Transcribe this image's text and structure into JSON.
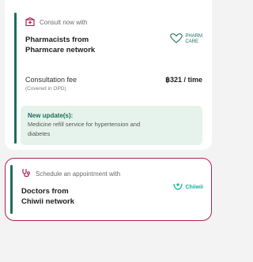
{
  "pharmacy_card": {
    "consult_label": "Consult now with",
    "title_line1": "Pharmacists from",
    "title_line2": "Pharmcare network",
    "brand_line1": "PHARM",
    "brand_line2": "CARE",
    "fee_label": "Consultation fee",
    "fee_value": "฿321 / time",
    "fee_note": "(Covered in OPD)",
    "update_title": "New update(s):",
    "update_text_line1": "Medicine refill service for hypertension and",
    "update_text_line2": "diabetes"
  },
  "doctor_card": {
    "schedule_label": "Schedule an appointment with",
    "title_line1": "Doctors from",
    "title_line2": "Chiwii network",
    "brand": "Chiiwii"
  },
  "colors": {
    "accent_green": "#1d6e5a",
    "accent_pink": "#b2214f",
    "update_bg": "#e6f3ec"
  }
}
